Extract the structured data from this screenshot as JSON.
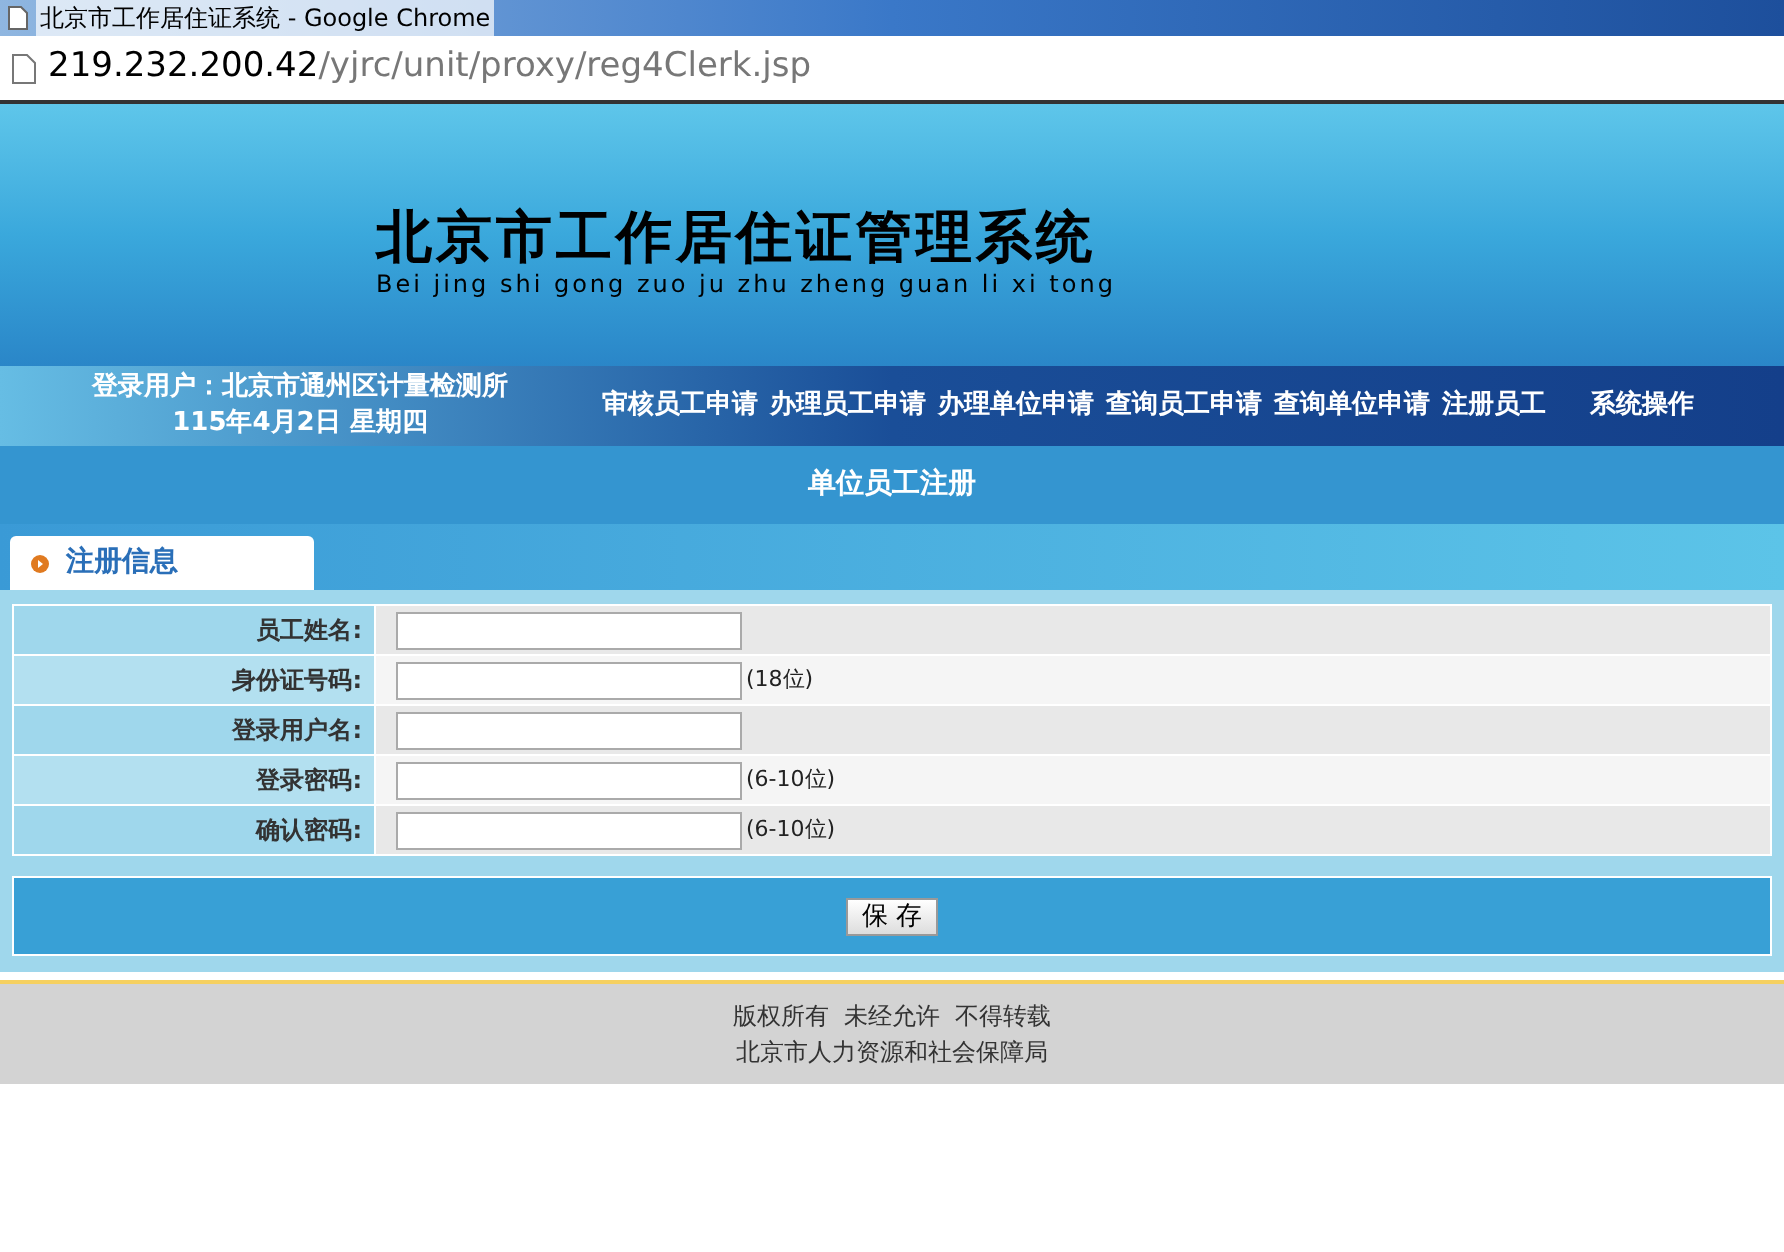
{
  "window": {
    "title": "北京市工作居住证系统 - Google Chrome",
    "url_host": "219.232.200.42",
    "url_path": "/yjrc/unit/proxy/reg4Clerk.jsp"
  },
  "banner": {
    "title": "北京市工作居住证管理系统",
    "subtitle": "Bei jing shi gong zuo ju zhu zheng guan li xi tong"
  },
  "user_info": {
    "login": "登录用户：北京市通州区计量检测所",
    "date": "115年4月2日  星期四"
  },
  "nav": [
    "审核员工申请",
    "办理员工申请",
    "办理单位申请",
    "查询员工申请",
    "查询单位申请",
    "注册员工",
    "系统操作"
  ],
  "page_title": "单位员工注册",
  "tab": {
    "label": "注册信息"
  },
  "fields": [
    {
      "label": "员工姓名:"
    },
    {
      "label": "身份证号码:",
      "hint": "(18位)"
    },
    {
      "label": "登录用户名:"
    },
    {
      "label": "登录密码:",
      "hint": "(6-10位)"
    },
    {
      "label": "确认密码:",
      "hint": "(6-10位)"
    }
  ],
  "save_button": "保 存",
  "footer": [
    "版权所有  未经允许  不得转载",
    "北京市人力资源和社会保障局"
  ]
}
